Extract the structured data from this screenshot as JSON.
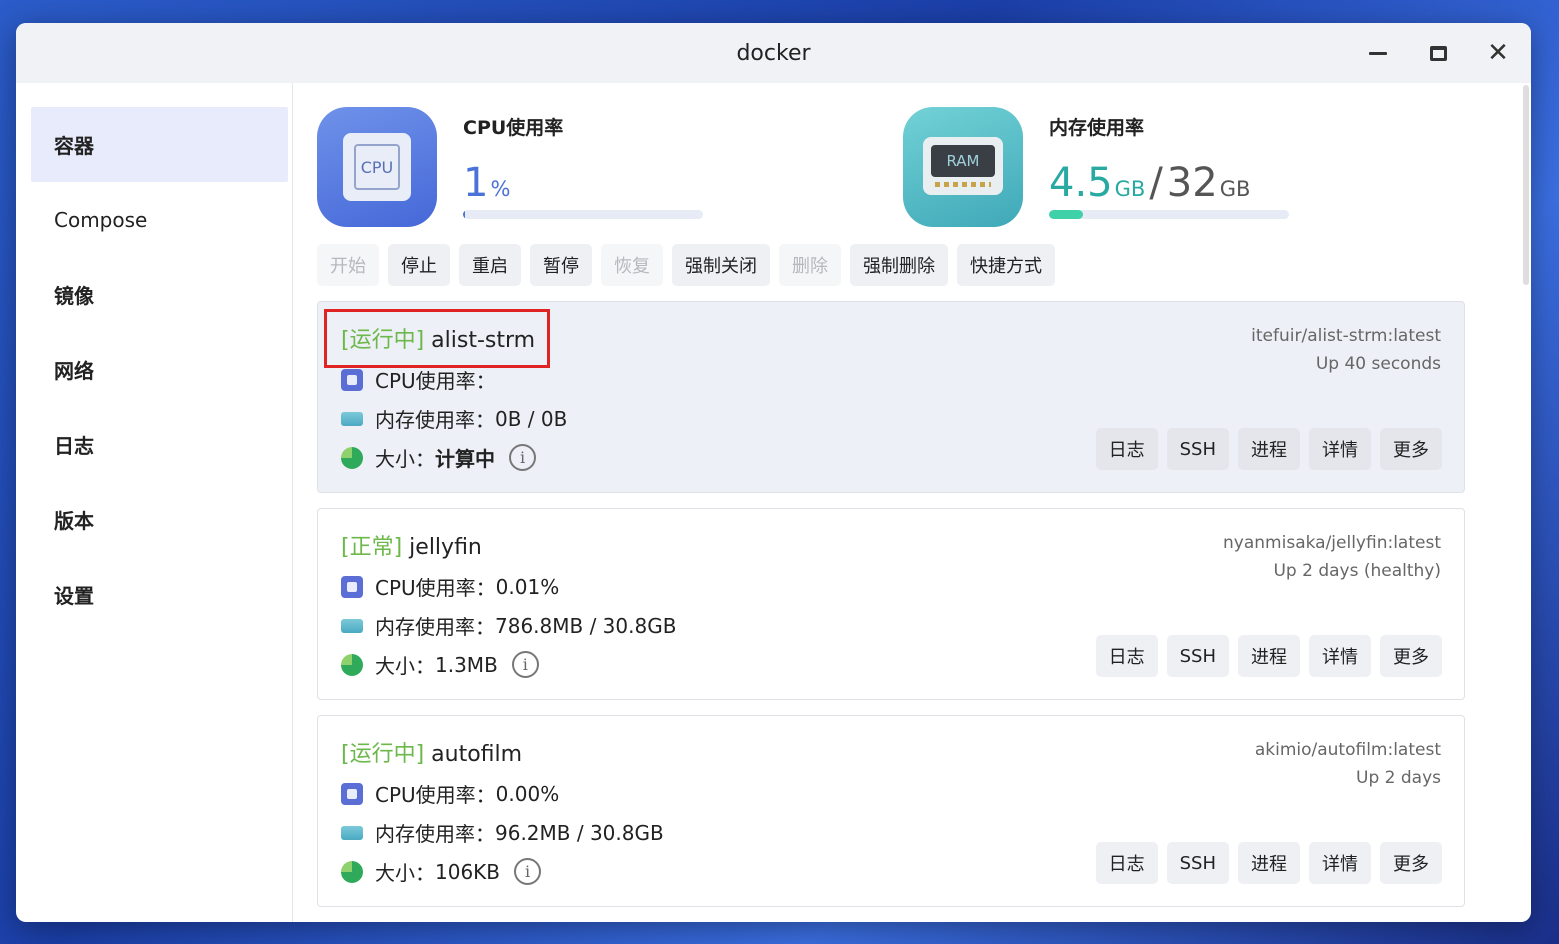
{
  "window": {
    "title": "docker"
  },
  "sidebar": {
    "items": [
      {
        "label": "容器",
        "active": true
      },
      {
        "label": "Compose"
      },
      {
        "label": "镜像"
      },
      {
        "label": "网络"
      },
      {
        "label": "日志"
      },
      {
        "label": "版本"
      },
      {
        "label": "设置"
      }
    ]
  },
  "stats": {
    "cpu": {
      "label": "CPU使用率",
      "value": "1",
      "unit": "%",
      "icon_text": "CPU",
      "usage_fraction": 0.01
    },
    "memory": {
      "label": "内存使用率",
      "used": "4.5",
      "used_unit": "GB",
      "separator": "/",
      "total": "32",
      "total_unit": "GB",
      "icon_text": "RAM",
      "usage_fraction": 0.14
    }
  },
  "toolbar": {
    "buttons": [
      {
        "label": "开始",
        "disabled": true
      },
      {
        "label": "停止"
      },
      {
        "label": "重启"
      },
      {
        "label": "暂停"
      },
      {
        "label": "恢复",
        "disabled": true
      },
      {
        "label": "强制关闭"
      },
      {
        "label": "删除",
        "disabled": true
      },
      {
        "label": "强制删除"
      },
      {
        "label": "快捷方式"
      }
    ]
  },
  "labels": {
    "cpu": "CPU使用率：",
    "memory": "内存使用率：",
    "size": "大小："
  },
  "actions": [
    "日志",
    "SSH",
    "进程",
    "详情",
    "更多"
  ],
  "containers": [
    {
      "status": "[运行中]",
      "name": "alist-strm",
      "image": "itefuir/alist-strm:latest",
      "uptime": "Up 40 seconds",
      "cpu": "",
      "memory": "0B / 0B",
      "size": "计算中",
      "selected": true,
      "highlighted": true
    },
    {
      "status": "[正常]",
      "name": "jellyfin",
      "image": "nyanmisaka/jellyfin:latest",
      "uptime": "Up 2 days (healthy)",
      "cpu": "0.01%",
      "memory": "786.8MB / 30.8GB",
      "size": "1.3MB"
    },
    {
      "status": "[运行中]",
      "name": "autofilm",
      "image": "akimio/autofilm:latest",
      "uptime": "Up 2 days",
      "cpu": "0.00%",
      "memory": "96.2MB / 30.8GB",
      "size": "106KB"
    }
  ],
  "colors": {
    "status_green": "#6cb84a",
    "accent_blue": "#4a72d8",
    "accent_teal": "#28a9a2",
    "highlight_red": "#e02424"
  }
}
